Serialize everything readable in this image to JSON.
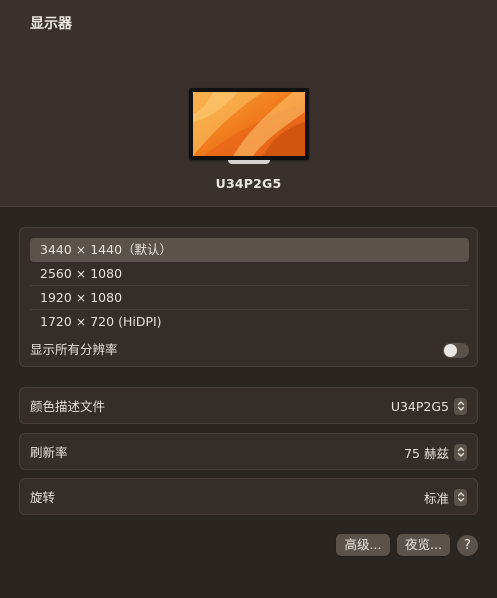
{
  "page": {
    "title": "显示器"
  },
  "display": {
    "name": "U34P2G5"
  },
  "resolutions": {
    "items": [
      {
        "label": "3440 × 1440（默认）",
        "selected": true
      },
      {
        "label": "2560 × 1080",
        "selected": false
      },
      {
        "label": "1920 × 1080",
        "selected": false
      },
      {
        "label": "1720 × 720 (HiDPI)",
        "selected": false
      }
    ],
    "show_all_label": "显示所有分辨率",
    "show_all_enabled": false
  },
  "settings": {
    "color_profile": {
      "label": "颜色描述文件",
      "value": "U34P2G5"
    },
    "refresh_rate": {
      "label": "刷新率",
      "value": "75 赫兹"
    },
    "rotation": {
      "label": "旋转",
      "value": "标准"
    }
  },
  "buttons": {
    "advanced": "高级...",
    "night_shift": "夜览...",
    "help": "?"
  },
  "icons": {
    "stepper": "up-down-chevron-icon",
    "toggle": "toggle-switch",
    "wallpaper": "monitor-wallpaper-icon"
  },
  "colors": {
    "background": "#2b2522",
    "header": "#3a312c",
    "panel": "#342d29",
    "selected_row": "#5c524c",
    "wallpaper_orange": "#f2801e"
  }
}
